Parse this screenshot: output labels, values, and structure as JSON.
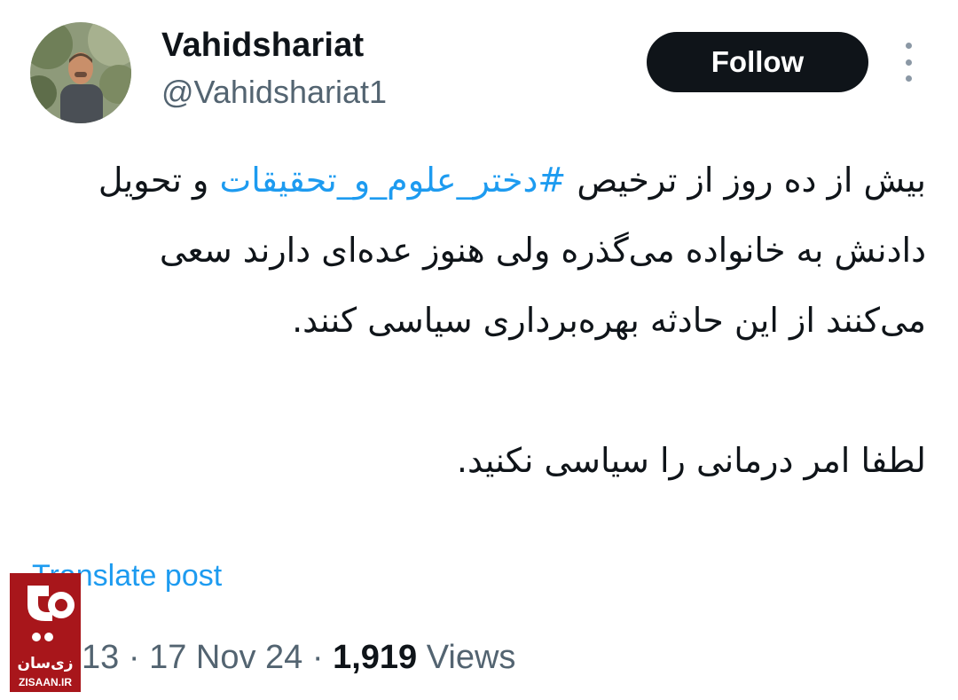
{
  "author": {
    "display_name": "Vahidshariat",
    "handle": "@Vahidshariat1"
  },
  "actions": {
    "follow_label": "Follow",
    "more_icon": "more-vertical-icon"
  },
  "tweet": {
    "text_before_hashtag": "بیش از ده روز از ترخیص ",
    "hashtag": "#دختر_علوم_و_تحقیقات",
    "text_after_hashtag": " و تحویل دادنش به خانواده می‌گذره ولی هنوز عده‌ای دارند سعی می‌کنند از این حادثه بهره‌برداری سیاسی کنند.",
    "second_paragraph": "لطفا امر درمانی را سیاسی نکنید."
  },
  "translate_label": "Translate post",
  "meta": {
    "time_partial": "13",
    "separator": " · ",
    "date": "17 Nov 24",
    "views_count": "1,919",
    "views_label": "Views"
  },
  "watermark": {
    "title": "زی‌سان",
    "domain": "ZISAAN.IR"
  },
  "colors": {
    "link": "#1d9bf0",
    "text": "#0f1419",
    "muted": "#536471",
    "button_bg": "#0f1419",
    "watermark_bg": "#a8161b"
  }
}
